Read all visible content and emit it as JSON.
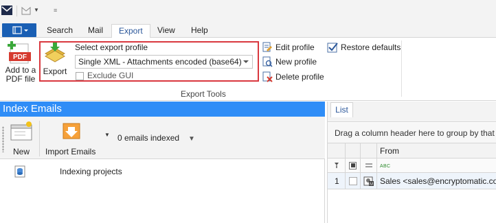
{
  "ribbon": {
    "tabs": {
      "search": "Search",
      "mail": "Mail",
      "export": "Export",
      "view": "View",
      "help": "Help"
    },
    "add_pdf": {
      "line1": "Add to a",
      "line2": "PDF file"
    },
    "export_label": "Export",
    "select_profile_label": "Select export profile",
    "profile_value": "Single XML - Attachments encoded (base64)",
    "exclude_gui_label": "Exclude GUI",
    "edit_profile": "Edit profile",
    "new_profile": "New profile",
    "delete_profile": "Delete profile",
    "restore_defaults": "Restore defaults",
    "group_caption": "Export Tools"
  },
  "left_pane": {
    "title": "Index Emails",
    "new_label": "New",
    "import_label": "Import Emails",
    "indexed_status": "0 emails indexed",
    "tree_item": "Indexing projects"
  },
  "right_pane": {
    "tab": "List",
    "group_hint": "Drag a column header here to group by that column",
    "columns": {
      "from": "From"
    },
    "rows": [
      {
        "index": "1",
        "from": "Sales <sales@encryptomatic.com>"
      }
    ]
  },
  "colors": {
    "accent": "#2f8df7",
    "file_tab": "#1a5fb4",
    "highlight": "#d9373e"
  }
}
